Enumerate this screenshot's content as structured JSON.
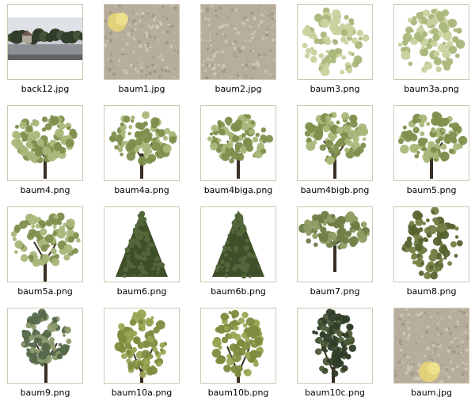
{
  "files": [
    {
      "name": "back12.jpg",
      "thumb": "landscape-photo"
    },
    {
      "name": "baum1.jpg",
      "thumb": "bark-lichen-texture"
    },
    {
      "name": "baum2.jpg",
      "thumb": "bark-texture"
    },
    {
      "name": "baum3.png",
      "thumb": "bush-light"
    },
    {
      "name": "baum3a.png",
      "thumb": "bush-light"
    },
    {
      "name": "baum4.png",
      "thumb": "deciduous-tree"
    },
    {
      "name": "baum4a.png",
      "thumb": "deciduous-tree"
    },
    {
      "name": "baum4biga.png",
      "thumb": "deciduous-tree"
    },
    {
      "name": "baum4bigb.png",
      "thumb": "deciduous-tree"
    },
    {
      "name": "baum5.png",
      "thumb": "deciduous-tree"
    },
    {
      "name": "baum5a.png",
      "thumb": "deciduous-tree-wide"
    },
    {
      "name": "baum6.png",
      "thumb": "conifer-dark"
    },
    {
      "name": "baum6b.png",
      "thumb": "conifer-dark"
    },
    {
      "name": "baum7.png",
      "thumb": "pine-tree"
    },
    {
      "name": "baum8.png",
      "thumb": "weeping-tree"
    },
    {
      "name": "baum9.png",
      "thumb": "sparse-tree"
    },
    {
      "name": "baum10a.png",
      "thumb": "tall-bushy-tree"
    },
    {
      "name": "baum10b.png",
      "thumb": "tall-bushy-tree"
    },
    {
      "name": "baum10c.png",
      "thumb": "tall-dark-tree"
    },
    {
      "name": "baum.jpg",
      "thumb": "bark-lichen-texture-bottom"
    }
  ],
  "colors": {
    "thumb_border": "#cfc7b3",
    "foliage_light": "#a9b77a",
    "foliage_mid": "#7e8f4d",
    "foliage_dark": "#3f4f2a",
    "bark": "#b6ad9d",
    "trunk": "#3a2f25",
    "lichen": "#e1d27a"
  }
}
